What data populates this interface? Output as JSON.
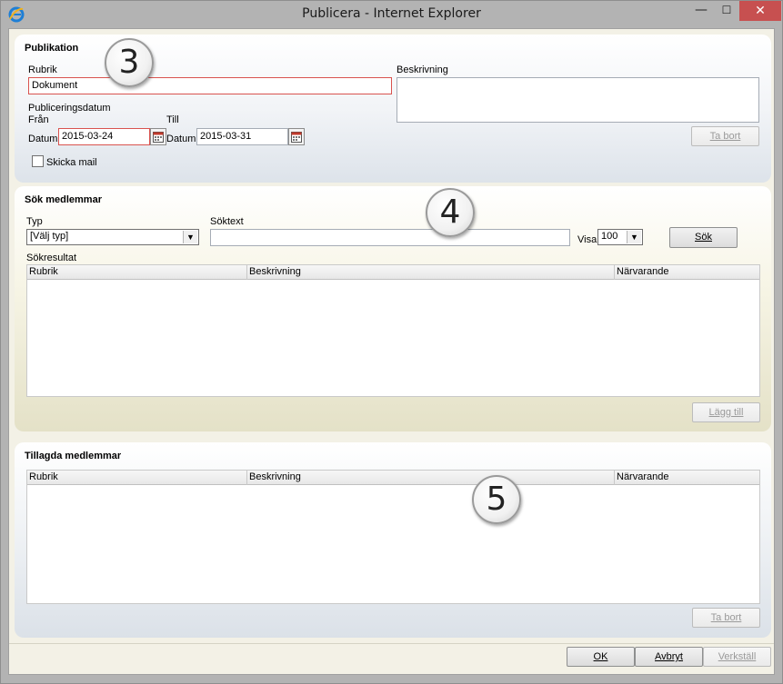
{
  "window": {
    "title": "Publicera - Internet Explorer",
    "min_glyph": "—",
    "max_glyph": "☐",
    "close_glyph": "✕"
  },
  "publikation": {
    "section_title": "Publikation",
    "rubrik_label": "Rubrik",
    "rubrik_value": "Dokument",
    "beskrivning_label": "Beskrivning",
    "publiceringsdatum_label": "Publiceringsdatum",
    "fran_label": "Från",
    "till_label": "Till",
    "datum_from_label": "Datum",
    "datum_from_value": "2015-03-24",
    "datum_to_label": "Datum",
    "datum_to_value": "2015-03-31",
    "skicka_mail_label": "Skicka mail",
    "ta_bort_label": "Ta bort"
  },
  "sok": {
    "section_title": "Sök medlemmar",
    "typ_label": "Typ",
    "typ_value": "[Välj typ]",
    "soktext_label": "Söktext",
    "soktext_value": "",
    "visa_label": "Visa",
    "visa_value": "100",
    "sok_button": "Sök",
    "sokresultat_label": "Sökresultat",
    "columns": [
      "Rubrik",
      "Beskrivning",
      "Närvarande"
    ],
    "lagg_till_label": "Lägg till"
  },
  "tillagda": {
    "section_title": "Tillagda medlemmar",
    "columns": [
      "Rubrik",
      "Beskrivning",
      "Närvarande"
    ],
    "ta_bort_label": "Ta bort"
  },
  "footer": {
    "ok_label": "OK",
    "avbryt_label": "Avbryt",
    "verkstall_label": "Verkställ"
  },
  "callouts": [
    "3",
    "4",
    "5"
  ],
  "icons": {
    "app": "internet-explorer-icon",
    "calendar": "calendar-icon",
    "dropdown": "chevron-down-icon"
  },
  "colors": {
    "required_border": "#d9534f",
    "close_button": "#c75050",
    "titlebar": "#b3b3b3"
  }
}
